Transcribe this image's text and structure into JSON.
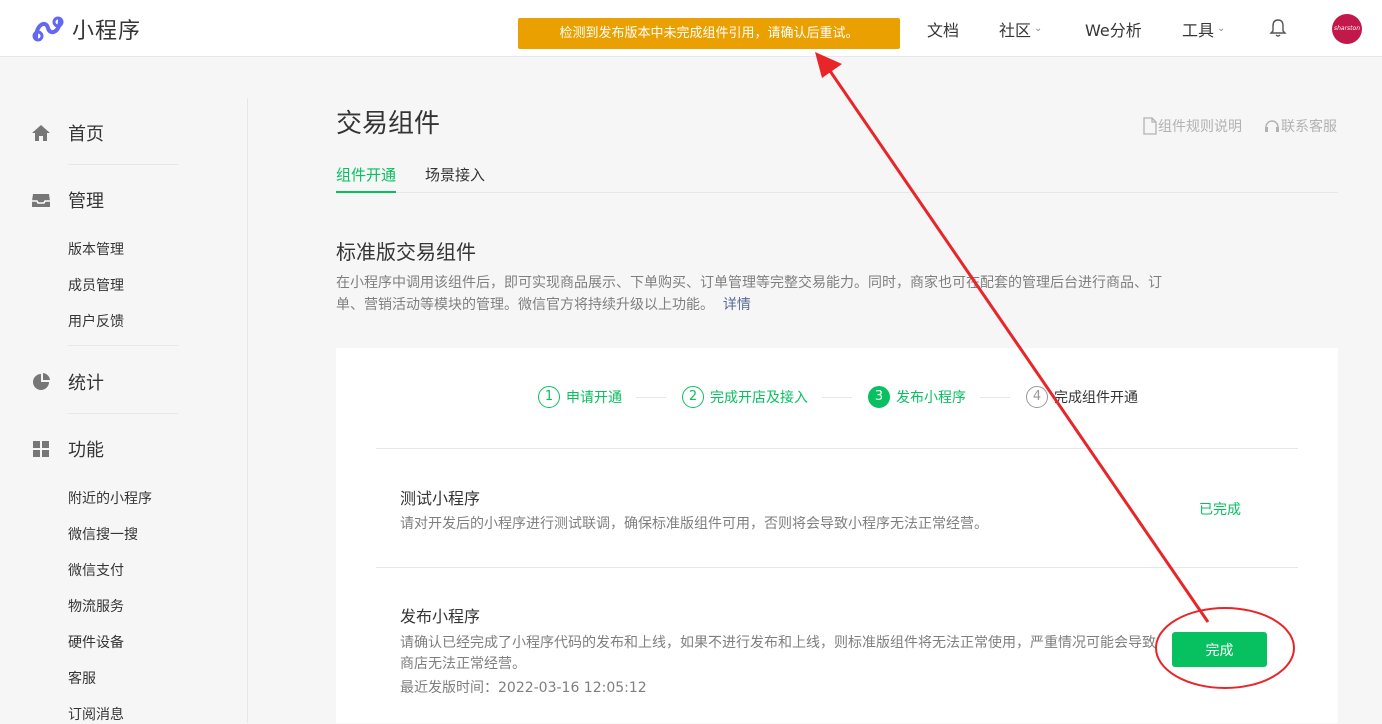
{
  "header": {
    "app_title": "小程序",
    "alert_text": "检测到发布版本中未完成组件引用，请确认后重试。",
    "nav": {
      "docs": "文档",
      "community": "社区",
      "analytics": "We分析",
      "tools": "工具"
    },
    "avatar_text": "sharston"
  },
  "sidebar": {
    "home": "首页",
    "manage": "管理",
    "manage_items": [
      "版本管理",
      "成员管理",
      "用户反馈"
    ],
    "stats": "统计",
    "features": "功能",
    "feature_items": [
      "附近的小程序",
      "微信搜一搜",
      "微信支付",
      "物流服务",
      "硬件设备",
      "客服",
      "订阅消息"
    ]
  },
  "main": {
    "title": "交易组件",
    "rules_link": "组件规则说明",
    "support_link": "联系客服",
    "tabs": [
      "组件开通",
      "场景接入"
    ],
    "section_title": "标准版交易组件",
    "section_desc": "在小程序中调用该组件后，即可实现商品展示、下单购买、订单管理等完整交易能力。同时，商家也可在配套的管理后台进行商品、订单、营销活动等模块的管理。微信官方将持续升级以上功能。",
    "section_link": "详情",
    "steps": [
      {
        "num": "1",
        "label": "申请开通"
      },
      {
        "num": "2",
        "label": "完成开店及接入"
      },
      {
        "num": "3",
        "label": "发布小程序"
      },
      {
        "num": "4",
        "label": "完成组件开通"
      }
    ],
    "task1": {
      "title": "测试小程序",
      "desc": "请对开发后的小程序进行测试联调，确保标准版组件可用，否则将会导致小程序无法正常经营。",
      "status": "已完成"
    },
    "task2": {
      "title": "发布小程序",
      "desc_line1": "请确认已经完成了小程序代码的发布和上线，如果不进行发布和上线，则标准版组件将无法正常使用，严重情况可能会导致",
      "desc_line2": "商店无法正常经营。",
      "release_time": "最近发版时间：2022-03-16 12:05:12",
      "button": "完成"
    }
  },
  "colors": {
    "accent": "#07c160",
    "alert": "#eaa000",
    "annotation": "#e8262a"
  }
}
